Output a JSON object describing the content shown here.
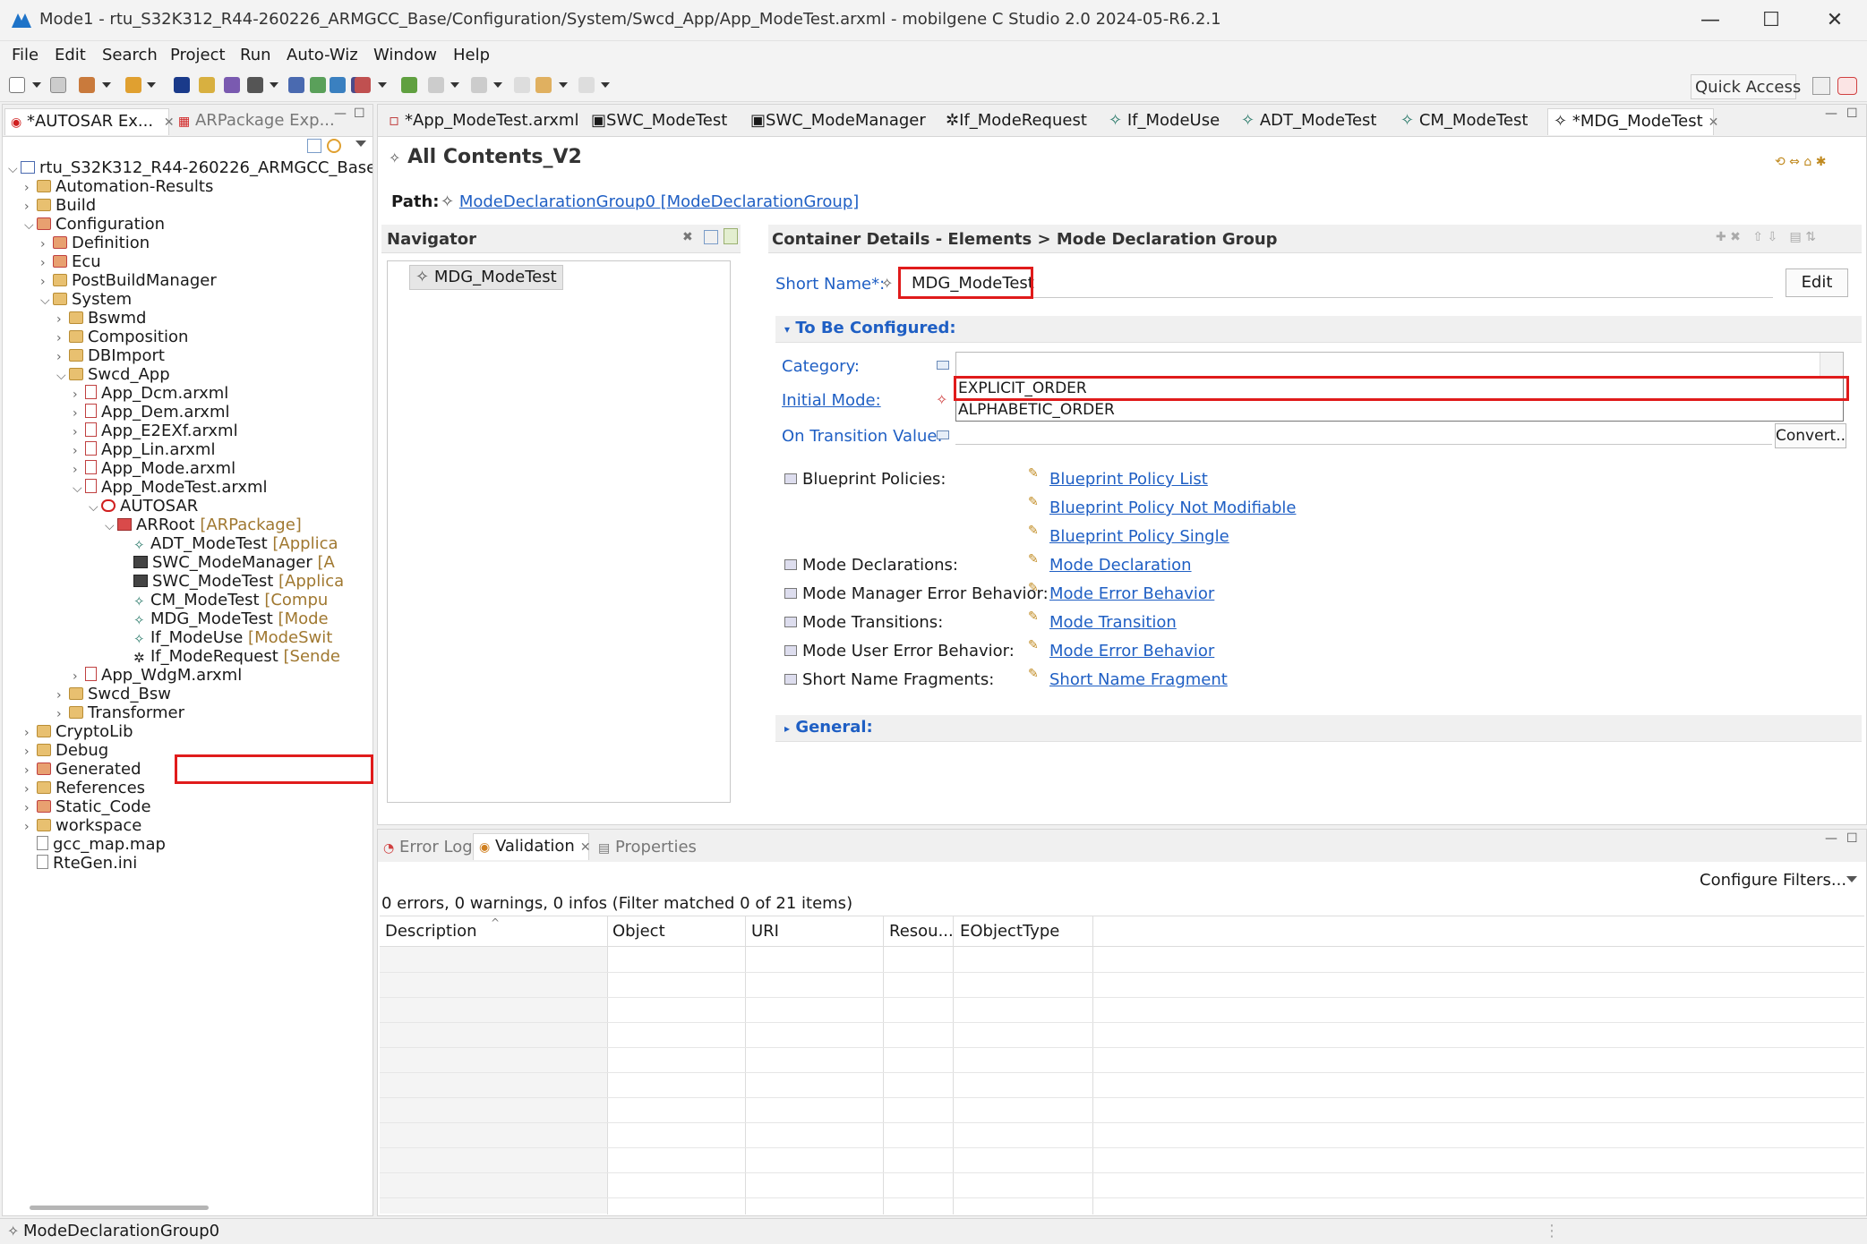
{
  "window": {
    "title": "Mode1 - rtu_S32K312_R44-260226_ARMGCC_Base/Configuration/System/Swcd_App/App_ModeTest.arxml - mobilgene C Studio 2.0 2024-05-R6.2.1",
    "minimize": "—",
    "maximize": "☐",
    "close": "✕"
  },
  "menu": [
    "File",
    "Edit",
    "Search",
    "Project",
    "Run",
    "Auto-Wiz",
    "Window",
    "Help"
  ],
  "quick_access": "Quick Access",
  "left_tabs": [
    {
      "label": "*AUTOSAR Ex..."
    },
    {
      "label": "ARPackage Exp..."
    }
  ],
  "tree": [
    {
      "label": "rtu_S32K312_R44-260226_ARMGCC_Base",
      "suffix": "",
      "icon": "project-icon",
      "chev": "⌵",
      "level": 0
    },
    {
      "label": "Automation-Results",
      "suffix": "",
      "icon": "folder-icon",
      "chev": "›",
      "level": 1
    },
    {
      "label": "Build",
      "suffix": "",
      "icon": "folder-icon",
      "chev": "›",
      "level": 1
    },
    {
      "label": "Configuration",
      "suffix": "",
      "icon": "package-folder-icon",
      "chev": "⌵",
      "level": 1
    },
    {
      "label": "Definition",
      "suffix": "",
      "icon": "package-folder-icon",
      "chev": "›",
      "level": 2
    },
    {
      "label": "Ecu",
      "suffix": "",
      "icon": "package-folder-icon",
      "chev": "›",
      "level": 2
    },
    {
      "label": "PostBuildManager",
      "suffix": "",
      "icon": "folder-icon",
      "chev": "›",
      "level": 2
    },
    {
      "label": "System",
      "suffix": "",
      "icon": "folder-icon",
      "chev": "⌵",
      "level": 2
    },
    {
      "label": "Bswmd",
      "suffix": "",
      "icon": "folder-icon",
      "chev": "›",
      "level": 3
    },
    {
      "label": "Composition",
      "suffix": "",
      "icon": "folder-icon",
      "chev": "›",
      "level": 3
    },
    {
      "label": "DBImport",
      "suffix": "",
      "icon": "folder-icon",
      "chev": "›",
      "level": 3
    },
    {
      "label": "Swcd_App",
      "suffix": "",
      "icon": "folder-icon",
      "chev": "⌵",
      "level": 3
    },
    {
      "label": "App_Dcm.arxml",
      "suffix": "",
      "icon": "arxml-file-icon",
      "chev": "›",
      "level": 4
    },
    {
      "label": "App_Dem.arxml",
      "suffix": "",
      "icon": "arxml-file-icon",
      "chev": "›",
      "level": 4
    },
    {
      "label": "App_E2EXf.arxml",
      "suffix": "",
      "icon": "arxml-file-icon",
      "chev": "›",
      "level": 4
    },
    {
      "label": "App_Lin.arxml",
      "suffix": "",
      "icon": "arxml-file-icon",
      "chev": "›",
      "level": 4
    },
    {
      "label": "App_Mode.arxml",
      "suffix": "",
      "icon": "arxml-file-icon",
      "chev": "›",
      "level": 4
    },
    {
      "label": "App_ModeTest.arxml",
      "suffix": "",
      "icon": "arxml-file-icon",
      "chev": "⌵",
      "level": 4
    },
    {
      "label": "AUTOSAR",
      "suffix": "",
      "icon": "autosar-icon",
      "chev": "⌵",
      "level": 5
    },
    {
      "label": "ARRoot",
      "suffix": " [ARPackage]",
      "icon": "arpackage-icon",
      "chev": "⌵",
      "level": 6
    },
    {
      "label": "ADT_ModeTest",
      "suffix": " [Applica",
      "icon": "element-icon",
      "chev": "",
      "level": 7
    },
    {
      "label": "SWC_ModeManager",
      "suffix": " [A",
      "icon": "swc-icon",
      "chev": "",
      "level": 7
    },
    {
      "label": "SWC_ModeTest",
      "suffix": " [Applica",
      "icon": "swc-icon",
      "chev": "",
      "level": 7
    },
    {
      "label": "CM_ModeTest",
      "suffix": " [Compu",
      "icon": "element-icon",
      "chev": "",
      "level": 7
    },
    {
      "label": "MDG_ModeTest",
      "suffix": " [Mode",
      "icon": "element-icon",
      "chev": "",
      "level": 7
    },
    {
      "label": "If_ModeUse",
      "suffix": " [ModeSwit",
      "icon": "element-icon",
      "chev": "",
      "level": 7
    },
    {
      "label": "If_ModeRequest",
      "suffix": " [Sende",
      "icon": "interface-icon",
      "chev": "",
      "level": 7
    },
    {
      "label": "App_WdgM.arxml",
      "suffix": "",
      "icon": "arxml-file-icon",
      "chev": "›",
      "level": 4
    },
    {
      "label": "Swcd_Bsw",
      "suffix": "",
      "icon": "folder-icon",
      "chev": "›",
      "level": 3
    },
    {
      "label": "Transformer",
      "suffix": "",
      "icon": "folder-icon",
      "chev": "›",
      "level": 3
    },
    {
      "label": "CryptoLib",
      "suffix": "",
      "icon": "folder-icon",
      "chev": "›",
      "level": 1
    },
    {
      "label": "Debug",
      "suffix": "",
      "icon": "folder-icon",
      "chev": "›",
      "level": 1
    },
    {
      "label": "Generated",
      "suffix": "",
      "icon": "package-folder-icon",
      "chev": "›",
      "level": 1
    },
    {
      "label": "References",
      "suffix": "",
      "icon": "folder-icon",
      "chev": "›",
      "level": 1
    },
    {
      "label": "Static_Code",
      "suffix": "",
      "icon": "package-folder-icon",
      "chev": "›",
      "level": 1
    },
    {
      "label": "workspace",
      "suffix": "",
      "icon": "folder-icon",
      "chev": "›",
      "level": 1
    },
    {
      "label": "gcc_map.map",
      "suffix": "",
      "icon": "file-icon",
      "chev": "",
      "level": 1
    },
    {
      "label": "RteGen.ini",
      "suffix": "",
      "icon": "file-icon",
      "chev": "",
      "level": 1
    }
  ],
  "editor_tabs": [
    {
      "label": "*App_ModeTest.arxml"
    },
    {
      "label": "SWC_ModeTest"
    },
    {
      "label": "SWC_ModeManager"
    },
    {
      "label": "If_ModeRequest"
    },
    {
      "label": "If_ModeUse"
    },
    {
      "label": "ADT_ModeTest"
    },
    {
      "label": "CM_ModeTest"
    },
    {
      "label": "*MDG_ModeTest"
    }
  ],
  "editor": {
    "title": "All Contents_V2",
    "path_label": "Path:",
    "path_value": "ModeDeclarationGroup0 [ModeDeclarationGroup]",
    "navigator_title": "Navigator",
    "navigator_item": "MDG_ModeTest",
    "details_title": "Container Details - Elements > Mode Declaration Group",
    "short_name_label": "Short Name*:",
    "short_name_value": "MDG_ModeTest",
    "edit_button": "Edit",
    "section_to_be_configured": "To Be Configured:",
    "category_label": "Category:",
    "initial_mode_label": "Initial Mode:",
    "dropdown_options": [
      "EXPLICIT_ORDER",
      "ALPHABETIC_ORDER"
    ],
    "on_transition_label": "On Transition Value:",
    "convert_button": "Convert..",
    "references": [
      {
        "label": "Blueprint Policies:",
        "links": [
          "Blueprint Policy List",
          "Blueprint Policy Not Modifiable",
          "Blueprint Policy Single"
        ]
      },
      {
        "label": "Mode Declarations:",
        "links": [
          "Mode Declaration"
        ]
      },
      {
        "label": "Mode Manager Error Behavior:",
        "links": [
          "Mode Error Behavior"
        ]
      },
      {
        "label": "Mode Transitions:",
        "links": [
          "Mode Transition"
        ]
      },
      {
        "label": "Mode User Error Behavior:",
        "links": [
          "Mode Error Behavior"
        ]
      },
      {
        "label": "Short Name Fragments:",
        "links": [
          "Short Name Fragment"
        ]
      }
    ],
    "section_general": "General:"
  },
  "bottom": {
    "tabs": [
      "Error Log",
      "Validation",
      "Properties"
    ],
    "configure_filters": "Configure Filters...",
    "summary": "0 errors, 0 warnings, 0 infos (Filter matched 0 of 21 items)",
    "columns": [
      "Description",
      "Object",
      "URI",
      "Resou...",
      "EObjectType"
    ]
  },
  "status": "ModeDeclarationGroup0",
  "colors": {
    "highlight": "#e01b1b",
    "link": "#1f5fc4"
  }
}
